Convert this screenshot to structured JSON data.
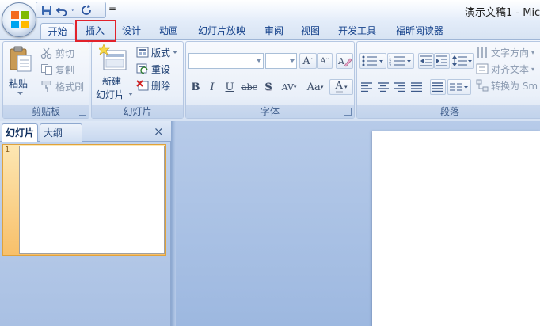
{
  "window": {
    "title": "演示文稿1 - Mic"
  },
  "quick_access": {
    "icons": [
      "save-icon",
      "undo-icon",
      "redo-icon",
      "customize-icon"
    ],
    "separator": "="
  },
  "tabs": [
    {
      "label": "开始",
      "active": true
    },
    {
      "label": "插入",
      "active": false,
      "highlighted": true
    },
    {
      "label": "设计",
      "active": false
    },
    {
      "label": "动画",
      "active": false
    },
    {
      "label": "幻灯片放映",
      "active": false
    },
    {
      "label": "审阅",
      "active": false
    },
    {
      "label": "视图",
      "active": false
    },
    {
      "label": "开发工具",
      "active": false
    },
    {
      "label": "福昕阅读器",
      "active": false
    }
  ],
  "clipboard": {
    "paste": "粘贴",
    "cut": "剪切",
    "copy": "复制",
    "format_painter": "格式刷",
    "label": "剪贴板"
  },
  "slides_group": {
    "new_slide_line1": "新建",
    "new_slide_line2": "幻灯片",
    "layout": "版式",
    "reset": "重设",
    "delete": "删除",
    "label": "幻灯片"
  },
  "font_group": {
    "font_name": "",
    "font_size": "",
    "grow": "A",
    "shrink": "A",
    "bold": "B",
    "italic": "I",
    "underline": "U",
    "strike": "abc",
    "shadow": "S",
    "spacing": "AV",
    "case": "Aa",
    "color": "A",
    "label": "字体"
  },
  "paragraph_group": {
    "text_direction": "文字方向",
    "align_text": "对齐文本",
    "convert_smartart": "转换为 Sm",
    "label": "段落"
  },
  "left_pane": {
    "tab_slides": "幻灯片",
    "tab_outline": "大纲",
    "close": "×",
    "slide_number": "1"
  },
  "colors": {
    "accent_highlight": "#e2222b",
    "ribbon_text": "#15428b",
    "selected_slide": "#f8c06a"
  }
}
